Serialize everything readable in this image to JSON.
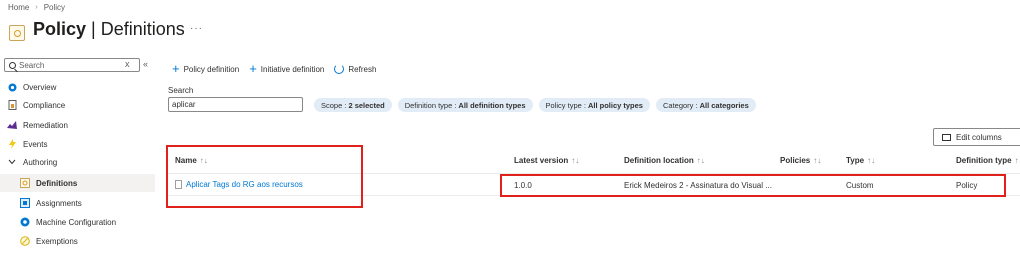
{
  "breadcrumb": {
    "home": "Home",
    "separator": "›",
    "current": "Policy"
  },
  "page": {
    "title_bold": "Policy",
    "title_sep": " | ",
    "title_rest": "Definitions",
    "more": "···"
  },
  "sidebar": {
    "search_placeholder": "Search",
    "collapse_x": "x",
    "collapse_arrows": "«",
    "items": [
      {
        "label": "Overview",
        "icon": "overview-icon"
      },
      {
        "label": "Compliance",
        "icon": "compliance-icon"
      },
      {
        "label": "Remediation",
        "icon": "remediation-icon"
      },
      {
        "label": "Events",
        "icon": "lightning-icon"
      },
      {
        "label": "Authoring",
        "icon": "chevron-down-icon"
      },
      {
        "label": "Definitions",
        "icon": "definitions-icon"
      },
      {
        "label": "Assignments",
        "icon": "assignments-icon"
      },
      {
        "label": "Machine Configuration",
        "icon": "machine-config-icon"
      },
      {
        "label": "Exemptions",
        "icon": "exemptions-icon"
      }
    ]
  },
  "toolbar": {
    "policy_definition": "Policy definition",
    "initiative_definition": "Initiative definition",
    "refresh": "Refresh"
  },
  "search": {
    "label": "Search",
    "value": "aplicar"
  },
  "filters": [
    {
      "key": "Scope : ",
      "value": "2 selected"
    },
    {
      "key": "Definition type : ",
      "value": "All definition types"
    },
    {
      "key": "Policy type : ",
      "value": "All policy types"
    },
    {
      "key": "Category : ",
      "value": "All categories"
    }
  ],
  "edit_columns": "Edit columns",
  "table": {
    "headers": [
      "Name",
      "Latest version",
      "Definition location",
      "Policies",
      "Type",
      "Definition type"
    ],
    "sort_glyph": "↑↓",
    "rows": [
      {
        "name": "Aplicar Tags do RG aos recursos",
        "latest_version": "1.0.0",
        "definition_location": "Erick Medeiros 2 - Assinatura do Visual ...",
        "policies": "",
        "type": "Custom",
        "definition_type": "Policy"
      }
    ]
  },
  "colors": {
    "accent": "#0078d4",
    "annotation_red": "#e0211b",
    "pill_bg": "#e1ecf7"
  }
}
